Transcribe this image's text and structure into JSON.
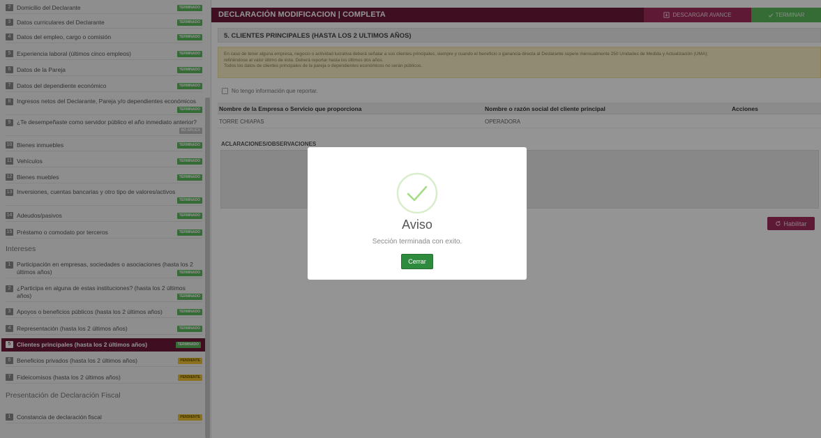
{
  "sidebar": {
    "items": [
      {
        "num": "2",
        "label": "Domicilio del Declarante",
        "status": "TERMINADO",
        "kind": "ok"
      },
      {
        "num": "3",
        "label": "Datos curriculares del Declarante",
        "status": "TERMINADO",
        "kind": "ok"
      },
      {
        "num": "4",
        "label": "Datos del empleo, cargo o comisión",
        "status": "TERMINADO",
        "kind": "ok"
      },
      {
        "num": "5",
        "label": "Experiencia laboral (últimos cinco empleos)",
        "status": "TERMINADO",
        "kind": "ok"
      },
      {
        "num": "6",
        "label": "Datos de la Pareja",
        "status": "TERMINADO",
        "kind": "ok"
      },
      {
        "num": "7",
        "label": "Datos del dependiente económico",
        "status": "TERMINADO",
        "kind": "ok"
      },
      {
        "num": "8",
        "label": "Ingresos netos del Declarante, Pareja y/o dependientes económicos",
        "status": "TERMINADO",
        "kind": "ok"
      },
      {
        "num": "9",
        "label": "¿Te desempeñaste como servidor público el año inmediato anterior?",
        "status": "NO APLICA",
        "kind": "na"
      },
      {
        "num": "10",
        "label": "Bienes inmuebles",
        "status": "TERMINADO",
        "kind": "ok"
      },
      {
        "num": "11",
        "label": "Vehículos",
        "status": "TERMINADO",
        "kind": "ok"
      },
      {
        "num": "12",
        "label": "Bienes muebles",
        "status": "TERMINADO",
        "kind": "ok"
      },
      {
        "num": "13",
        "label": "Inversiones, cuentas bancarias y otro tipo de valores/activos",
        "status": "TERMINADO",
        "kind": "ok"
      },
      {
        "num": "14",
        "label": "Adeudos/pasivos",
        "status": "TERMINADO",
        "kind": "ok"
      },
      {
        "num": "15",
        "label": "Préstamo o comodato por terceros",
        "status": "TERMINADO",
        "kind": "ok"
      }
    ],
    "section_interests": "Intereses",
    "interest_items": [
      {
        "num": "1",
        "label": "Participación en empresas, sociedades o asociaciones (hasta los 2 últimos años)",
        "status": "TERMINADO",
        "kind": "ok"
      },
      {
        "num": "2",
        "label": "¿Participa en alguna de estas instituciones? (hasta los 2 últimos años)",
        "status": "TERMINADO",
        "kind": "ok"
      },
      {
        "num": "3",
        "label": "Apoyos o beneficios públicos (hasta los 2 últimos años)",
        "status": "TERMINADO",
        "kind": "ok"
      },
      {
        "num": "4",
        "label": "Representación (hasta los 2 últimos años)",
        "status": "TERMINADO",
        "kind": "ok"
      },
      {
        "num": "5",
        "label": "Clientes principales (hasta los 2 últimos años)",
        "status": "TERMINADO",
        "kind": "ok"
      },
      {
        "num": "6",
        "label": "Beneficios privados (hasta los 2 últimos años)",
        "status": "PENDIENTE",
        "kind": "pend"
      },
      {
        "num": "7",
        "label": "Fideicomisos (hasta los 2 últimos años)",
        "status": "PENDIENTE",
        "kind": "pend"
      }
    ],
    "section_fiscal": "Presentación de Declaración Fiscal",
    "fiscal_items": [
      {
        "num": "1",
        "label": "Constancia de declaración fiscal",
        "status": "PENDIENTE",
        "kind": "pend"
      }
    ]
  },
  "header": {
    "title": "DECLARACIÓN MODIFICACION | COMPLETA",
    "download_label": "DESCARGAR AVANCE",
    "finish_label": "TERMINAR"
  },
  "section": {
    "title": "5. CLIENTES PRINCIPALES (HASTA LOS 2 ULTIMOS AÑOS)",
    "alert_line1": "En caso de tener alguna empresa, negocio o actividad lucrativa deberá señalar a sus clientes principales, siempre y cuando el beneficio o ganancia directa al Declarante supere mensualmente 250 Unidades de Medida y Actualización (UMA);",
    "alert_line2": "refiriéndose al valor último de ésta. Deberá reportar hasta los últimos dos años.",
    "alert_line3": "Todos los datos de clientes principales de la pareja o dependientes económicos no serán públicos.",
    "no_info_label": "No tengo información que reportar."
  },
  "table": {
    "headers": [
      "Nombre de la Empresa o Servicio que proporciona",
      "Nombre o razón social del cliente principal",
      "Acciones"
    ],
    "rows": [
      [
        "TORRE CHIAPAS",
        "OPERADORA",
        ""
      ]
    ]
  },
  "observations": {
    "label": "ACLARACIONES/OBSERVACIONES",
    "value": ""
  },
  "habilitar_label": "Habilitar",
  "modal": {
    "title": "Aviso",
    "message": "Sección terminada con exito.",
    "button": "Cerrar",
    "icon": "success-check-icon",
    "accent": "#a5dc86"
  },
  "colors": {
    "brand": "#6d1b3a",
    "accent": "#a32b5a",
    "success": "#5cb85c",
    "pending": "#f0c330"
  }
}
